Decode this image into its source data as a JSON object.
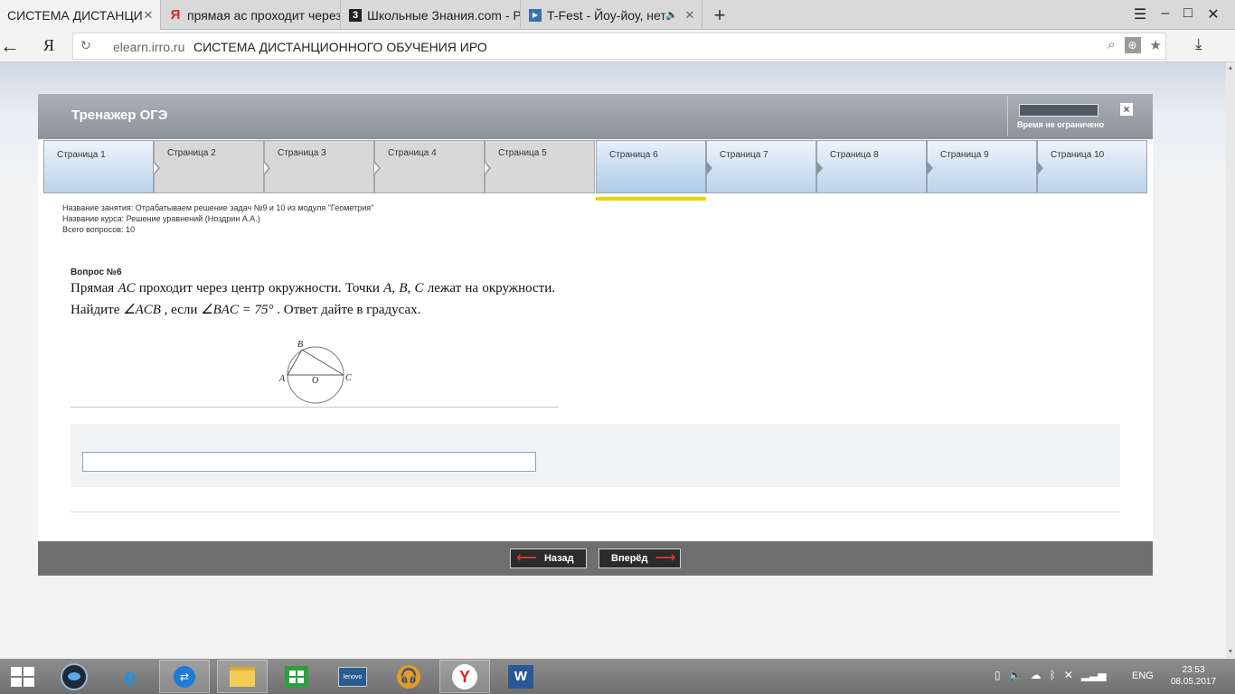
{
  "browser": {
    "tabs": [
      {
        "title": "СИСТЕМА ДИСТАНЦИОНН",
        "active": true,
        "favicon": "none"
      },
      {
        "title": "прямая ас проходит через ц",
        "active": false,
        "favicon": "yandex-icon"
      },
      {
        "title": "Школьные Знания.com - Ре",
        "active": false,
        "favicon": "znanija-icon"
      },
      {
        "title": "T-Fest - Йоу-йоу, нету",
        "active": false,
        "favicon": "video-icon"
      }
    ],
    "new_tab": "+",
    "yandex_logo": "Я",
    "url_domain": "elearn.irro.ru",
    "url_title": "СИСТЕМА ДИСТАНЦИОННОГО ОБУЧЕНИЯ ИРО"
  },
  "app": {
    "title": "Тренажер ОГЭ",
    "timer_label": "Время не ограничено",
    "close": "×"
  },
  "pages": [
    {
      "label": "Страница 1",
      "state": "unvisited"
    },
    {
      "label": "Страница 2",
      "state": "visited"
    },
    {
      "label": "Страница 3",
      "state": "visited"
    },
    {
      "label": "Страница 4",
      "state": "visited"
    },
    {
      "label": "Страница 5",
      "state": "visited"
    },
    {
      "label": "Страница 6",
      "state": "current"
    },
    {
      "label": "Страница 7",
      "state": "unvisited"
    },
    {
      "label": "Страница 8",
      "state": "unvisited"
    },
    {
      "label": "Страница 9",
      "state": "unvisited"
    },
    {
      "label": "Страница 10",
      "state": "unvisited"
    }
  ],
  "lesson": {
    "name_line": "Название занятия: Отрабатываем решение задач №9 и 10 из модуля \"Геометрия\"",
    "course_line": "Название курса: Решение уравнений (Ноздрин А.А.)",
    "total_line": "Всего вопросов: 10"
  },
  "question": {
    "number": "Вопрос №6",
    "text_1": "Прямая ",
    "ac": "AC",
    "text_2": " проходит через центр окружности. Точки ",
    "pa": "A",
    "comma_1": ", ",
    "pb": "B",
    "comma_2": ", ",
    "pc": "C",
    "text_3": " лежат на окружности. Найдите ",
    "angle_acb": "∠ACB",
    "text_4": " , если ",
    "angle_bac": "∠BAC = 75°",
    "text_5": " . Ответ дайте в градусах.",
    "figure_labels": {
      "b": "B",
      "a": "A",
      "o": "O",
      "c": "C"
    }
  },
  "answer": {
    "value": "",
    "placeholder": ""
  },
  "navigation": {
    "back_label": "Назад",
    "forward_label": "Вперёд"
  },
  "taskbar": {
    "apps": [
      "start-icon",
      "eye-app-icon",
      "internet-explorer-icon",
      "teamviewer-icon",
      "file-explorer-icon",
      "store-icon",
      "lenovo-icon",
      "music-icon",
      "yandex-browser-icon",
      "word-icon"
    ],
    "lenovo_text": "lenovo",
    "yandex_letter": "Y",
    "word_letter": "W",
    "lang": "ENG",
    "time": "23:53",
    "date": "08.05.2017"
  },
  "colors": {
    "header_gray": "#9aa1a8",
    "current_page_underline": "#f0d400",
    "footer_gray": "#6f6f6f",
    "nav_arrow_red": "#d9372e"
  }
}
